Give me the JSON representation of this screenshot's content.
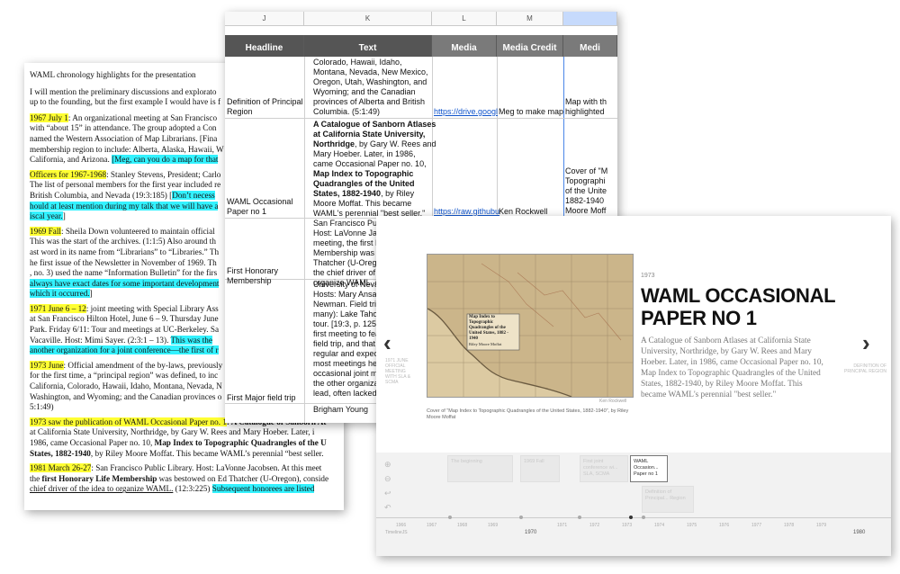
{
  "document": {
    "heading": "WAML chronology highlights for the presentation",
    "intro": [
      "I will mention the preliminary discussions and explorato",
      "up to the founding, but the first example I would have is f"
    ],
    "p1967": {
      "date": "1967 July 1",
      "l1": ": An organizational meeting at San Francisco",
      "l2": "with “about 15” in attendance.  The group adopted a Con",
      "l3": "named the Western Association of Map Librarians.  [Fina",
      "l4": "membership region to include: Alberta, Alaska, Hawaii, W",
      "l5a": "California, and Arizona.  ",
      "l5b": "[Meg, can you do a map for that"
    },
    "officers": {
      "date": "Officers for 1967-1968",
      "l1": ": Stanley Stevens, President; Carlo",
      "l2": "The list of personal members for the first year included re",
      "l3a": "British Columbia, and Nevada (19:3:185)  [",
      "l3b": "Don’t necess",
      "l4": "hould at least mention during my talk that we will have a",
      "l5": "iscal year.",
      "l5b": "]"
    },
    "p1969": {
      "date": "1969 Fall",
      "l1": ":  Sheila Down volunteered to maintain official",
      "l2": "This was the start of the archives.  (1:1:5)  Also around th",
      "l3": "ast word in its name from “Librarians” to “Libraries.”  Th",
      "l4": "he first issue of the Newsletter in November of 1969.  Th",
      "l5a": ", no. 3) used the name “Information Bulletin” for the firs",
      "l6": "always have exact dates for some important development",
      "l7a": "which it occurred.",
      "l7b": "]"
    },
    "p1971": {
      "date": "1971 June 6 – 12",
      "l1": ": joint meeting with Special Library Ass",
      "l2": "at San Francisco Hilton Hotel, June 6 – 9.  Thursday June",
      "l3": "Park.  Friday 6/11: Tour and meetings at UC-Berkeley.  Sa",
      "l4a": "Vacaville.  Host: Mimi Sayer. (2:3:1 – 13).  ",
      "l4b": "This was the",
      "l5": "another organization for a joint conference—the first of r"
    },
    "p1973": {
      "date": "1973 June",
      "l1": ": Official amendment of the by-laws, previously",
      "l2": "for the first time, a “principal region” was defined, to inc",
      "l3": "California, Colorado, Hawaii, Idaho, Montana, Nevada, N",
      "l4": "Washington, and Wyoming; and the Canadian provinces o",
      "l5": "5:1:49)"
    },
    "p1973b": {
      "date": "1973 saw the publication of WAML Occasional Paper no. 1",
      "l1b": ": A Catalogue of Sanborn At",
      "l2": "at California State University, Northridge, by Gary W. Rees and Mary Hoeber.  Later, i",
      "l3a": "1986, came Occasional Paper no. 10, ",
      "l3b": "Map Index to Topographic Quadrangles of the U",
      "l4a": "States, 1882-1940",
      "l4b": ", by Riley Moore Moffat.  This became WAML’s perennial “best seller."
    },
    "p1981": {
      "date": "1981 March 26-27",
      "l1": ": San Francisco Public Library.  Host: LaVonne Jacobsen.  At this meet",
      "l2a": "the ",
      "l2b": "first Honorary Life Membership",
      "l2c": " was bestowed on Ed Thatcher (U-Oregon), conside",
      "l3a": "chief driver of the idea to organize WAML.",
      "l3b": "  (12:3:225)  ",
      "l3c": "Subsequent honorees are listed"
    }
  },
  "sheet": {
    "col_letters": [
      "J",
      "K",
      "L",
      "M",
      ""
    ],
    "headers": [
      "Headline",
      "Text",
      "Media",
      "Media Credit",
      "Medi"
    ],
    "row1": {
      "headline": "Definition of Principal\nRegion",
      "text": "Colorado, Hawaii, Idaho,\nMontana, Nevada, New Mexico,\nOregon, Utah, Washington, and\nWyoming; and the Canadian\nprovinces of Alberta and British\nColumbia. (5:1:49)",
      "media": "https://drive.googl",
      "credit": "Meg to make map",
      "caption": "Map with th\nhighlighted"
    },
    "row2": {
      "headline": "WAML Occasional\nPaper no 1",
      "text_bold1": "A Catalogue of Sanborn Atlases\nat California State University,\nNorthridge",
      "text_plain1": ", by Gary W. Rees and\nMary Hoeber. Later, in 1986,\ncame Occasional Paper no. 10,\n",
      "text_bold2": "Map Index to Topographic\nQuadrangles of the United\nStates, 1882-1940",
      "text_plain2": ", by Riley\nMoore Moffat. This became\nWAML's perennial \"best seller.\"",
      "media": "https://raw.githubu",
      "credit": "Ken Rockwell",
      "caption": "Cover of \"M\nTopographi\nof the Unite\n1882-1940\nMoore Moff"
    },
    "row3": {
      "headline": "First Honorary\nMembership",
      "text": "San Francisco Publ\nHost: LaVonne Jaco\nmeeting, the first H\nMembership was b\nThatcher (U-Orego\nthe chief driver of t\norganize WAML. (1"
    },
    "row4": {
      "headline": "First Major field trip",
      "text": "University of Nevad\nHosts: Mary Ansari\nNewman. Field trip\nmany): Lake Tahoe-\ntour. [19:3, p. 125]\nfirst meeting to fea\nfield trip, and that b\nregular and expecte\nmost meetings hen\noccasional joint me\nthe other organizati\nlead, often lacked f"
    },
    "row5": {
      "text": "Brigham Young"
    }
  },
  "timeline": {
    "year": "1973",
    "title": "WAML OCCASIONAL PAPER NO 1",
    "description": "A Catalogue of Sanborn Atlases at California State University, Northridge, by Gary W. Rees and Mary Hoeber. Later, in 1986, came Occasional Paper no. 10, Map Index to Topographic Quadrangles of the United States, 1882-1940, by Riley Moore Moffat. This became WAML's perennial \"best seller.\"",
    "media_credit": "Ken Rockwell",
    "media_caption": "Cover of \"Map Index to Topographic Quadrangles of the United States, 1882-1940\", by Riley Moore Moffat",
    "map_label": "Map Index to Topographic Quadrangles of the United States, 1882 - 1940",
    "map_author": "Riley Moore Moffat",
    "prev_label": "1971 JUNE OFFICIAL MEETING WITH SLA & SCMA",
    "next_label": "DEFINITION OF PRINCIPAL REGION",
    "markers": [
      "The beginning",
      "1969 Fall",
      "First joint conference wi... SLA, SCMA",
      "WAML Occasion... Paper no 1",
      "Definition of Principal... Region"
    ],
    "ticks": [
      "1966",
      "1967",
      "1968",
      "1969",
      "1970",
      "1971",
      "1972",
      "1973",
      "1974",
      "1975",
      "1976",
      "1977",
      "1978",
      "1979",
      "1980"
    ],
    "timeline_word": "TimelineJS"
  },
  "colors": {
    "yellow": "#ffff33",
    "cyan": "#33f2ff",
    "header_grey": "#7a7a7a",
    "link": "#1155cc"
  }
}
